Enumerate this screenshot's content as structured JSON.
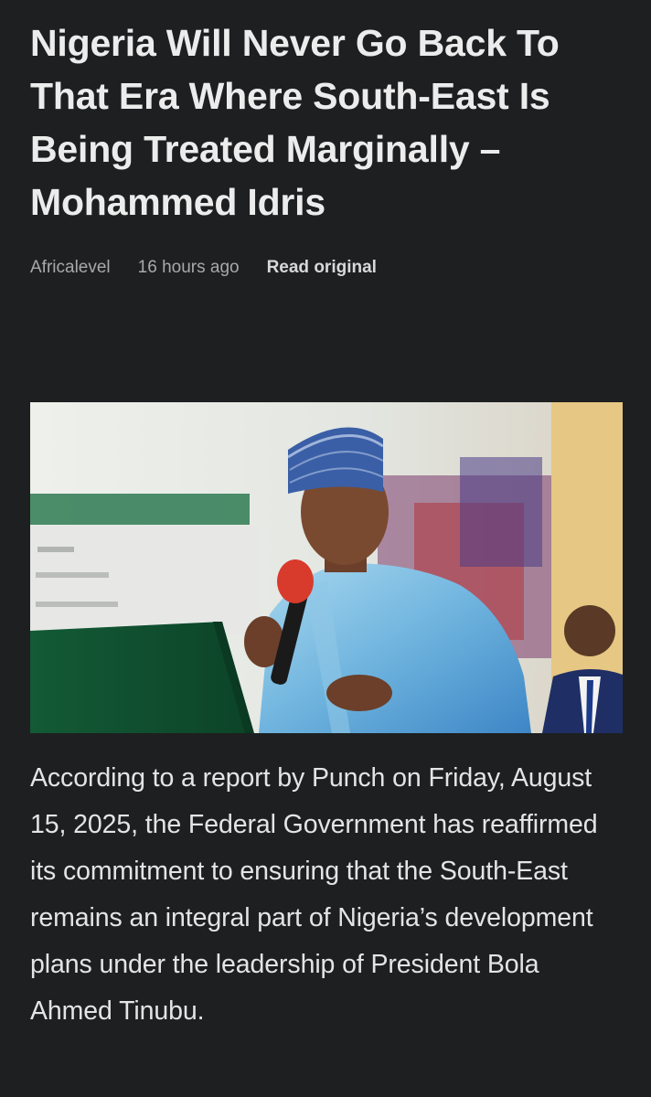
{
  "article": {
    "headline": "Nigeria Will Never Go Back To That Era Where South-East Is Being Treated Marginally – Mohammed Idris",
    "meta": {
      "source": "Africalevel",
      "time": "16 hours ago",
      "read_original_label": "Read original"
    },
    "hero_image": {
      "description": "Man in a blue embroidered cap and light blue agbada speaking into a red microphone at a green lectern"
    },
    "body": "According to a report by Punch on Friday, August 15, 2025, the Federal Government has reaffirmed its commitment to ensuring that the South-East remains an integral part of Nigeria’s development plans under the leadership of President Bola Ahmed Tinubu."
  },
  "colors": {
    "background": "#1e1f21",
    "headline": "#ececec",
    "meta": "#a9a9ab",
    "body": "#e4e4e4"
  }
}
